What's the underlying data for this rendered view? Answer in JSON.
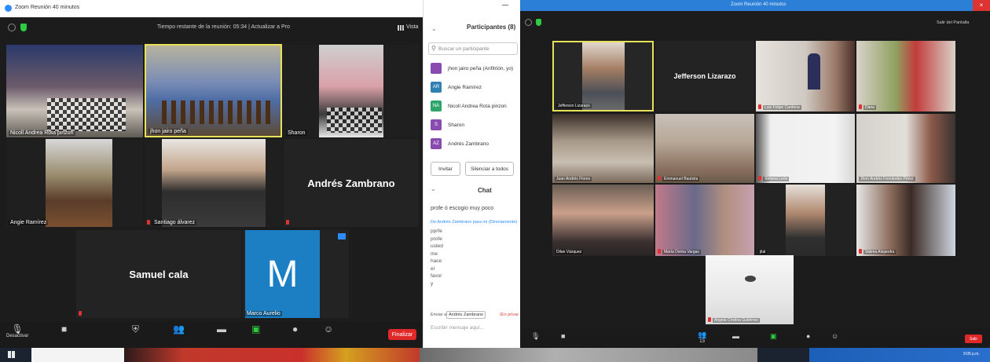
{
  "left_window": {
    "title": "Zoom Reunión 40 minutos",
    "meeting_timer": "Tiempo restante de la reunión: 05:34 | Actualizar a Pro",
    "view_button": "Vista",
    "tiles": [
      {
        "name": "Nicoll Andrea Rota pinzón"
      },
      {
        "name": "jhon jairo peña"
      },
      {
        "name": "Sharon"
      },
      {
        "name": "Angie Ramírez"
      },
      {
        "name": "Santiago álvarez"
      },
      {
        "name": "Andrés Zambrano"
      },
      {
        "name": "Samuel cala"
      },
      {
        "name": "Marco Aurelio",
        "initial": "M"
      }
    ],
    "toolbar": {
      "mute": "Desactivar",
      "end": "Finalizar"
    }
  },
  "participants_panel": {
    "header": "Participantes (8)",
    "search_placeholder": "Buscar un participante",
    "items": [
      {
        "initials": "",
        "name": "jhon jairo peña (Anfitrión, yo)",
        "color": "#8a4bb0"
      },
      {
        "initials": "AR",
        "name": "Angie Ramírez",
        "color": "#2f7fb0"
      },
      {
        "initials": "NA",
        "name": "Nicoll Andrea Rota pinzon",
        "color": "#2fa46a"
      },
      {
        "initials": "S",
        "name": "Sharon",
        "color": "#8a4bb0"
      },
      {
        "initials": "AZ",
        "name": "Andrés Zambrano",
        "color": "#8a4bb0"
      }
    ],
    "invite_button": "Invitar",
    "mute_all_button": "Silenciar a todos",
    "chat_header": "Chat",
    "chat_message_1": "profe ó escogio muy poco",
    "chat_from": "De Andrés Zambrano para mí (Directamente)",
    "chat_lines": [
      "pprfe",
      "profe",
      "usted",
      "me",
      "hace",
      "el",
      "favor",
      "y"
    ],
    "send_to_label": "Enviar a:",
    "send_to_value": "Andrés Zambrano",
    "send_to_suffix": "(En privado)",
    "message_placeholder": "Escribir mensaje aquí..."
  },
  "right_window": {
    "title": "Zoom Reunión 40 minutos",
    "exit_fullscreen": "Salir del Pantalla",
    "featured_name": "Jefferson Lizarazo",
    "tiles": [
      {
        "name": "Jefferson Lizarazo"
      },
      {
        "name": ""
      },
      {
        "name": "Luis Felipe Cardona"
      },
      {
        "name": "Dana"
      },
      {
        "name": "Juan Andrés Flores"
      },
      {
        "name": "Emmanuel Bautista"
      },
      {
        "name": "Ximena León"
      },
      {
        "name": "Jhon Andrés Fernández Pérez"
      },
      {
        "name": "Dilan Vázquez"
      },
      {
        "name": "María Divina Vargas"
      },
      {
        "name": "jilal"
      },
      {
        "name": "Valeria Alejandra"
      },
      {
        "name": "Angela Cristina Gutiérrez"
      }
    ],
    "toolbar": {
      "participants_count": "13",
      "end": "Salir"
    }
  },
  "taskbar": {
    "clock": "9:05 p.m."
  }
}
